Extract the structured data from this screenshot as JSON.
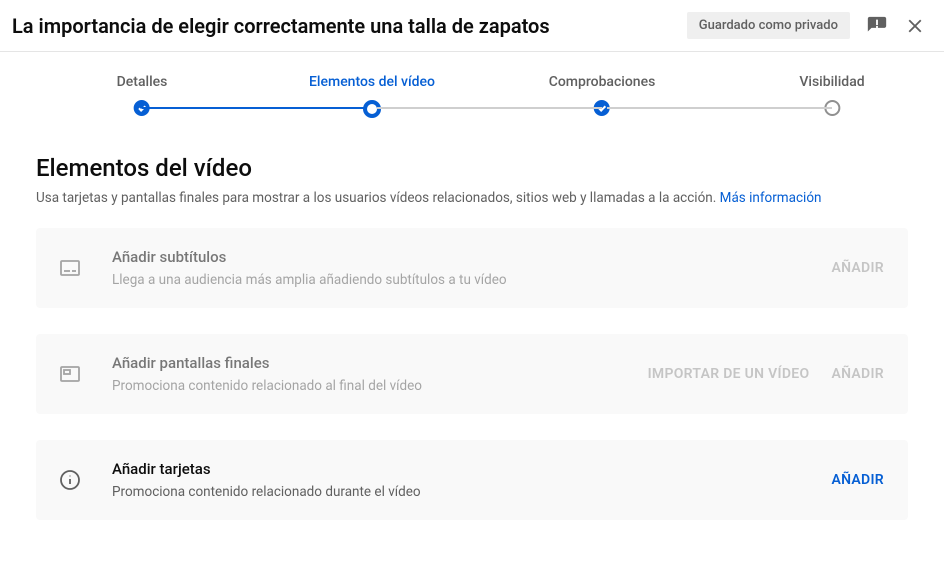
{
  "header": {
    "title": "La importancia de elegir correctamente una talla de zapatos",
    "save_badge": "Guardado como privado"
  },
  "stepper": {
    "steps": [
      {
        "label": "Detalles"
      },
      {
        "label": "Elementos del vídeo"
      },
      {
        "label": "Comprobaciones"
      },
      {
        "label": "Visibilidad"
      }
    ]
  },
  "section": {
    "title": "Elementos del vídeo",
    "subtitle": "Usa tarjetas y pantallas finales para mostrar a los usuarios vídeos relacionados, sitios web y llamadas a la acción. ",
    "more_info": "Más información"
  },
  "cards": [
    {
      "title": "Añadir subtítulos",
      "subtitle": "Llega a una audiencia más amplia añadiendo subtítulos a tu vídeo",
      "actions": [
        {
          "label": "AÑADIR"
        }
      ]
    },
    {
      "title": "Añadir pantallas finales",
      "subtitle": "Promociona contenido relacionado al final del vídeo",
      "actions": [
        {
          "label": "IMPORTAR DE UN VÍDEO"
        },
        {
          "label": "AÑADIR"
        }
      ]
    },
    {
      "title": "Añadir tarjetas",
      "subtitle": "Promociona contenido relacionado durante el vídeo",
      "actions": [
        {
          "label": "AÑADIR"
        }
      ]
    }
  ]
}
